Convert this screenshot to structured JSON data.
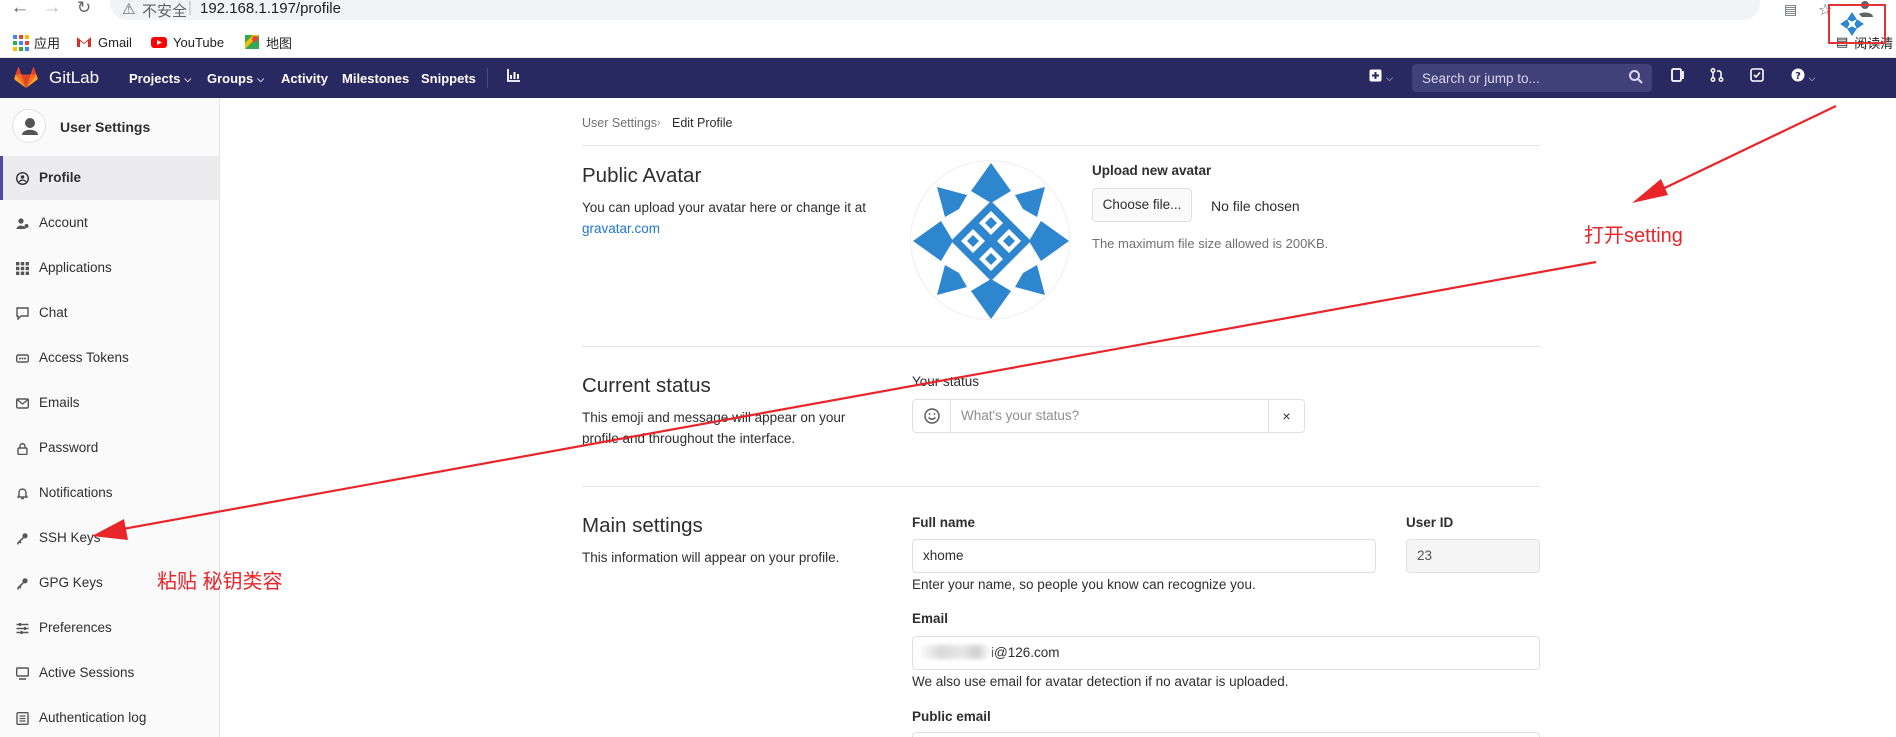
{
  "browser": {
    "insecure_label": "不安全",
    "url": "192.168.1.197/profile",
    "reading_mode": "阅读清",
    "bookmarks": [
      {
        "label": "应用",
        "icon": "apps-grid-icon"
      },
      {
        "label": "Gmail",
        "icon": "gmail-icon"
      },
      {
        "label": "YouTube",
        "icon": "youtube-icon"
      },
      {
        "label": "地图",
        "icon": "maps-icon"
      }
    ]
  },
  "header": {
    "brand": "GitLab",
    "nav": {
      "projects": "Projects",
      "groups": "Groups",
      "activity": "Activity",
      "milestones": "Milestones",
      "snippets": "Snippets"
    },
    "search_placeholder": "Search or jump to...",
    "colors": {
      "bar": "#292961",
      "search": "#41417a"
    }
  },
  "sidebar": {
    "title": "User Settings",
    "items": [
      {
        "label": "Profile",
        "icon": "profile-icon",
        "active": true
      },
      {
        "label": "Account",
        "icon": "account-icon"
      },
      {
        "label": "Applications",
        "icon": "applications-icon"
      },
      {
        "label": "Chat",
        "icon": "chat-icon"
      },
      {
        "label": "Access Tokens",
        "icon": "access-tokens-icon"
      },
      {
        "label": "Emails",
        "icon": "email-icon"
      },
      {
        "label": "Password",
        "icon": "lock-icon"
      },
      {
        "label": "Notifications",
        "icon": "bell-icon"
      },
      {
        "label": "SSH Keys",
        "icon": "key-icon"
      },
      {
        "label": "GPG Keys",
        "icon": "key-icon"
      },
      {
        "label": "Preferences",
        "icon": "preferences-icon"
      },
      {
        "label": "Active Sessions",
        "icon": "sessions-icon"
      },
      {
        "label": "Authentication log",
        "icon": "log-icon"
      }
    ]
  },
  "breadcrumb": {
    "parent": "User Settings",
    "current": "Edit Profile"
  },
  "avatar_section": {
    "title": "Public Avatar",
    "description": "You can upload your avatar here or change it at",
    "link": "gravatar.com",
    "upload_label": "Upload new avatar",
    "choose_button": "Choose file...",
    "no_file": "No file chosen",
    "max_size_note": "The maximum file size allowed is 200KB."
  },
  "status_section": {
    "title": "Current status",
    "description": "This emoji and message will appear on your profile and throughout the interface.",
    "label": "Your status",
    "placeholder": "What's your status?",
    "clear": "×"
  },
  "main_settings": {
    "title": "Main settings",
    "description": "This information will appear on your profile.",
    "full_name_label": "Full name",
    "full_name_value": "xhome",
    "full_name_help": "Enter your name, so people you know can recognize you.",
    "user_id_label": "User ID",
    "user_id_value": "23",
    "email_label": "Email",
    "email_value": "i@126.com",
    "email_help": "We also use email for avatar detection if no avatar is uploaded.",
    "public_email_label": "Public email"
  },
  "annotations": {
    "open_setting": "打开setting",
    "paste_key": "粘贴 秘钥类容",
    "color": "#e8262a"
  }
}
